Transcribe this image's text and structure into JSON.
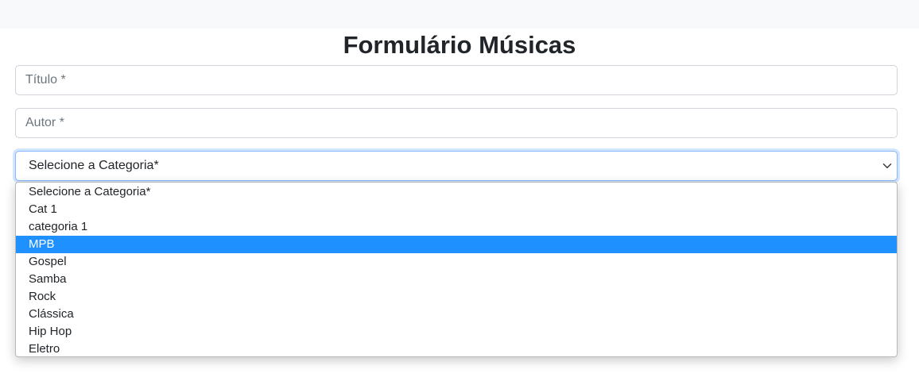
{
  "page": {
    "title": "Formulário Músicas"
  },
  "form": {
    "titulo_placeholder": "Título *",
    "autor_placeholder": "Autor *",
    "categoria_selected": "Selecione a Categoria*"
  },
  "dropdown": {
    "options": [
      "Selecione a Categoria*",
      "Cat 1",
      "categoria 1",
      "MPB",
      "Gospel",
      "Samba",
      "Rock",
      "Clássica",
      "Hip Hop",
      "Eletro"
    ],
    "highlighted": "MPB"
  },
  "colors": {
    "highlight": "#1e90ff",
    "focus_border": "#86b7fe",
    "primary": "#0d6efd",
    "topbar": "#f8f9fa"
  },
  "icons": {
    "select_arrow": "chevron-down-icon"
  }
}
